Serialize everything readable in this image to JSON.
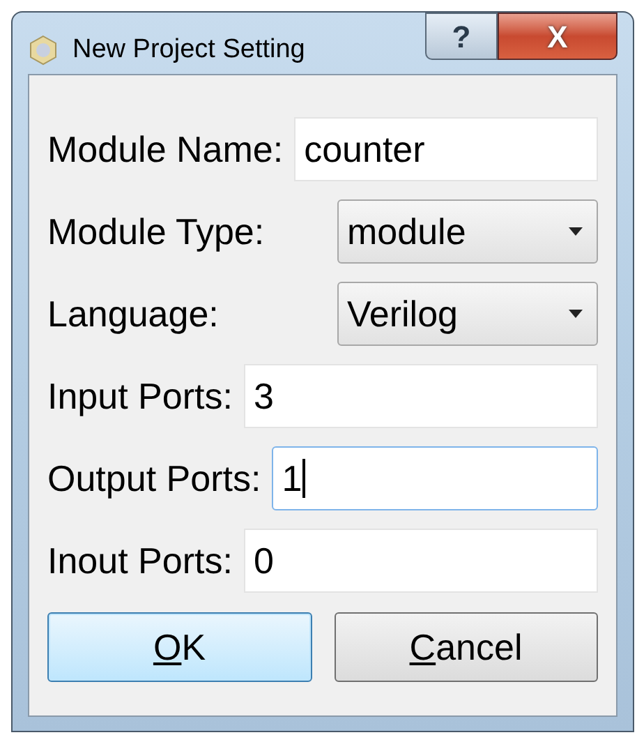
{
  "window": {
    "title": "New Project Setting",
    "help_button": "?",
    "close_button": "X"
  },
  "rows": [
    {
      "kind": "text",
      "label": "Module Name:",
      "value": "counter",
      "focused": false
    },
    {
      "kind": "select",
      "label": "Module Type:",
      "value": "module",
      "focused": false
    },
    {
      "kind": "select",
      "label": "Language:",
      "value": "Verilog",
      "focused": false
    },
    {
      "kind": "text",
      "label": "Input Ports:",
      "value": "3",
      "focused": false
    },
    {
      "kind": "text",
      "label": "Output Ports:",
      "value": "1",
      "focused": true
    },
    {
      "kind": "text",
      "label": "Inout Ports:",
      "value": "0",
      "focused": false
    }
  ],
  "buttons": [
    {
      "label": "OK",
      "mnemonic_first_letter": true,
      "default": true
    },
    {
      "label": "Cancel",
      "mnemonic_first_letter": true,
      "default": false
    }
  ]
}
